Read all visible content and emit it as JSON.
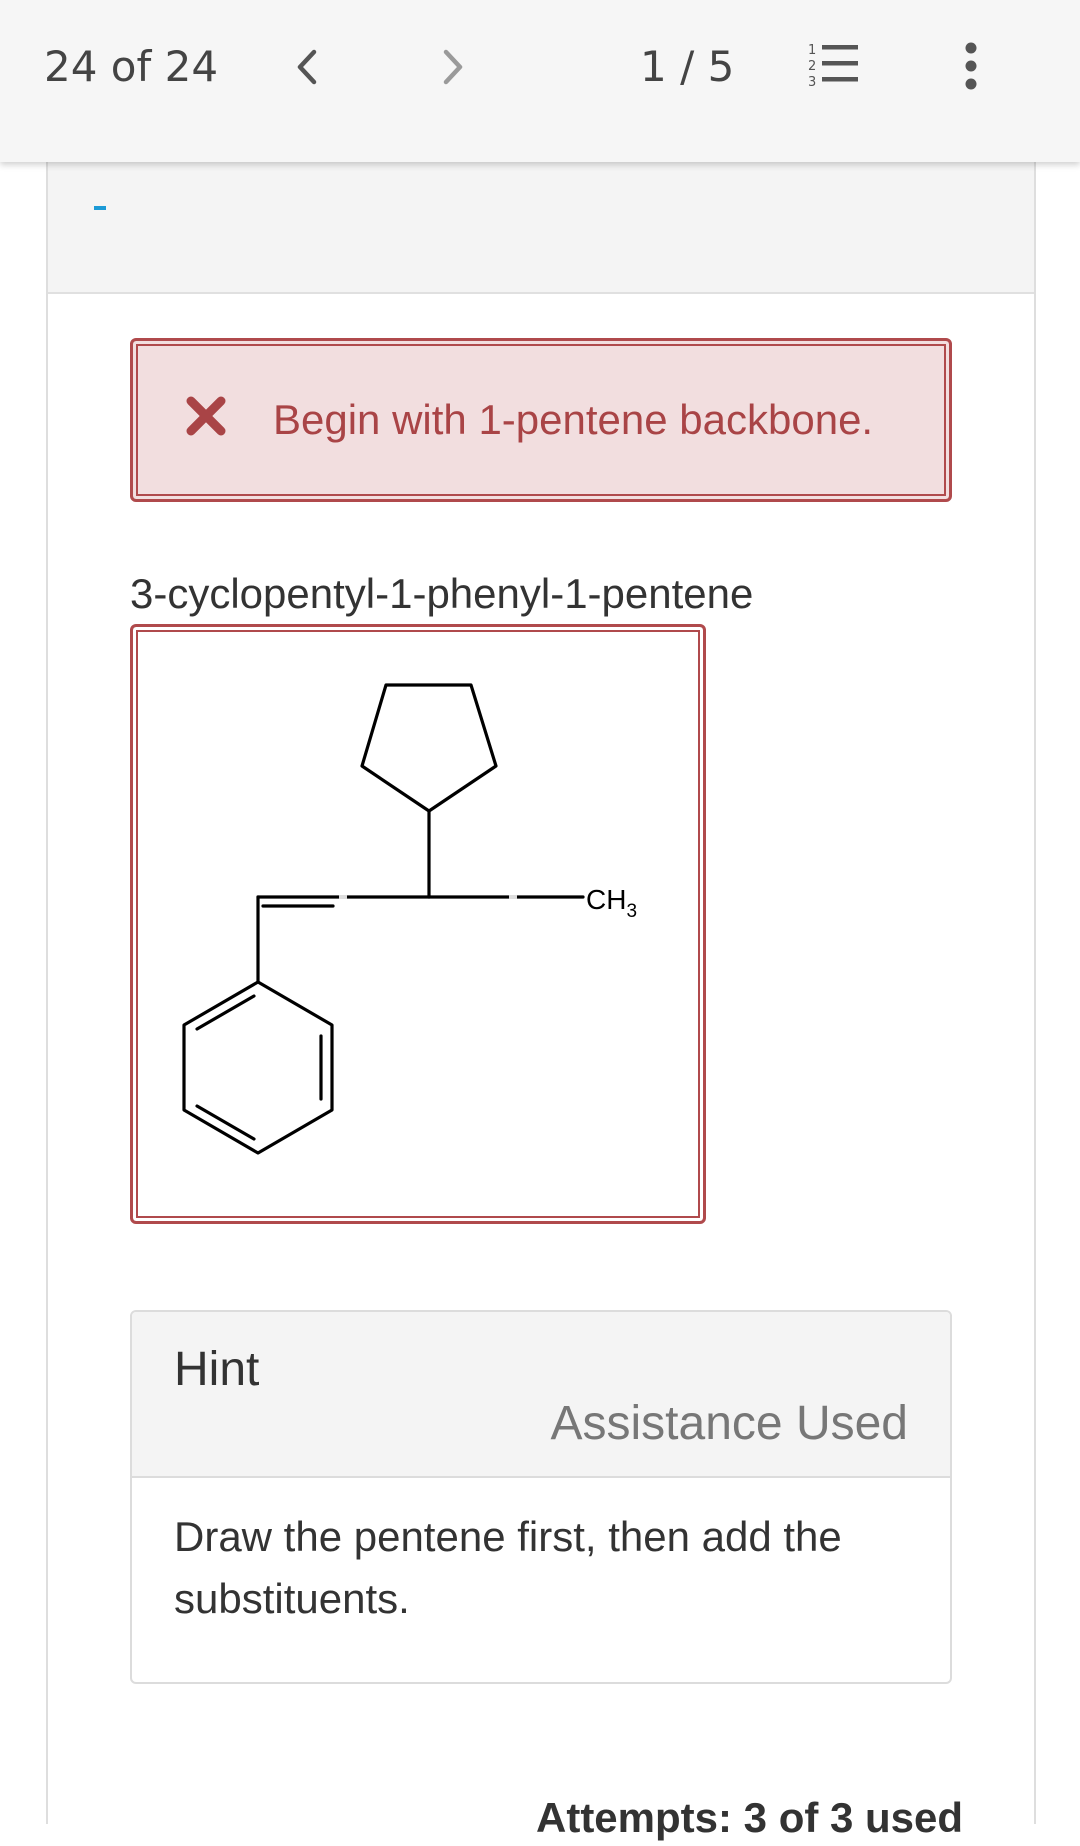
{
  "topbar": {
    "counter": "24 of 24",
    "prev_icon": "chevron-left-icon",
    "next_icon": "chevron-right-icon",
    "page": "1 / 5",
    "list_icon": "numbered-list-icon",
    "menu_icon": "more-vertical-icon"
  },
  "feedback": {
    "icon": "error-x-icon",
    "message": "Begin with 1-pentene backbone."
  },
  "question": {
    "title": "3-cyclopentyl-1-phenyl-1-pentene",
    "structure": {
      "label_main": "CH",
      "label_sub": "3"
    }
  },
  "hint": {
    "title": "Hint",
    "status": "Assistance Used",
    "body": "Draw the pentene first, then add the substituents."
  },
  "footer": {
    "attempts": "Attempts: 3 of 3 used"
  },
  "colors": {
    "error": "#a94446",
    "error_bg": "#f2dedf",
    "accent": "#1c9ad6"
  }
}
